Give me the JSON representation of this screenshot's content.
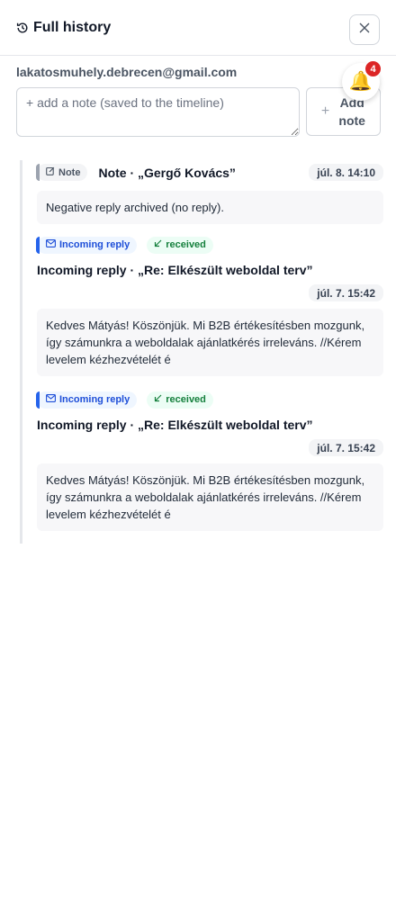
{
  "header": {
    "title": "Full history",
    "history_icon": "history-icon",
    "close_icon": "close-icon"
  },
  "contact": {
    "email": "lakatosmuhely.debrecen@gmail.com"
  },
  "notifications": {
    "icon": "bell-icon",
    "count": "4"
  },
  "note_composer": {
    "placeholder": "+ add a note (saved to the timeline)",
    "add_label": "Add note",
    "add_icon": "plus-icon"
  },
  "entries": [
    {
      "type_label": "Note",
      "type_icon": "edit-icon",
      "title": "Note · „Gergő Kovács”",
      "date": "júl. 8. 14:10",
      "body": "Negative reply archived (no reply)."
    },
    {
      "type_label": "Incoming reply",
      "type_icon": "mail-icon",
      "status_label": "received",
      "status_icon": "arrow-down-left-icon",
      "title": "Incoming reply · „Re: Elkészült weboldal terv”",
      "date": "júl. 7. 15:42",
      "body": "Kedves Mátyás! Köszönjük. Mi B2B értékesítésben mozgunk, így számunkra a weboldalak ajánlatkérés irreleváns. //Kérem levelem kézhezvételét é"
    },
    {
      "type_label": "Incoming reply",
      "type_icon": "mail-icon",
      "status_label": "received",
      "status_icon": "arrow-down-left-icon",
      "title": "Incoming reply · „Re: Elkészült weboldal terv”",
      "date": "júl. 7. 15:42",
      "body": "Kedves Mátyás! Köszönjük. Mi B2B értékesítésben mozgunk, így számunkra a weboldalak ajánlatkérés irreleváns. //Kérem levelem kézhezvételét é"
    }
  ],
  "colors": {
    "accent_blue": "#1d4ed8",
    "received_green": "#15803d",
    "badge_red": "#dc2626"
  }
}
